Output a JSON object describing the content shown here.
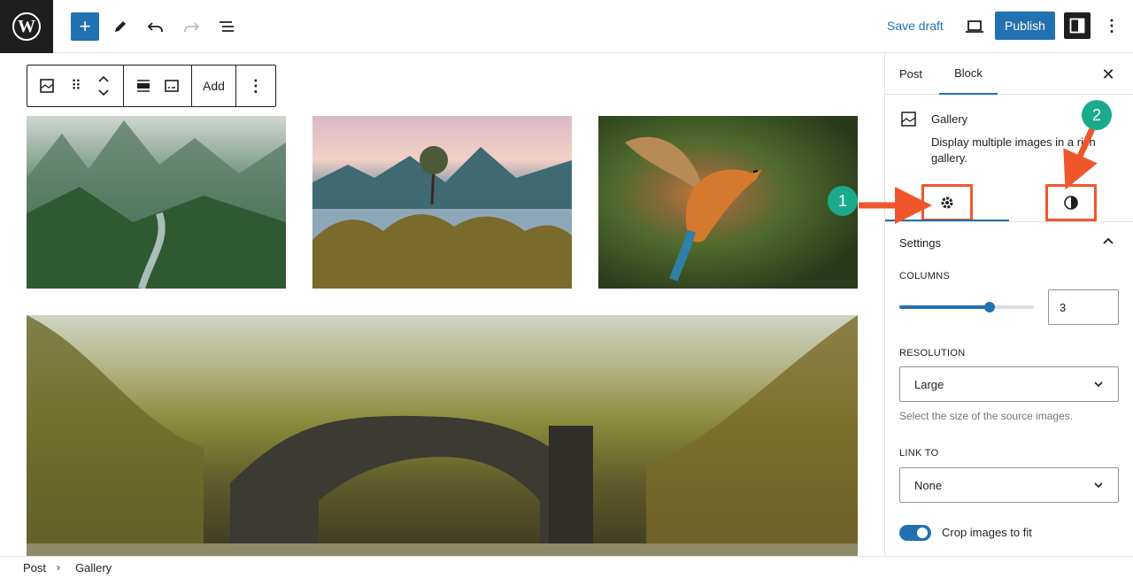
{
  "topbar": {
    "save_draft": "Save draft",
    "publish": "Publish"
  },
  "block_toolbar": {
    "add_label": "Add"
  },
  "sidebar": {
    "tabs": [
      {
        "label": "Post"
      },
      {
        "label": "Block"
      }
    ],
    "block_title": "Gallery",
    "block_description": "Display multiple images in a rich gallery.",
    "panel_title": "Settings",
    "columns_label": "COLUMNS",
    "columns_value": "3",
    "columns_fraction": 0.67,
    "resolution_label": "RESOLUTION",
    "resolution_value": "Large",
    "resolution_help": "Select the size of the source images.",
    "link_to_label": "LINK TO",
    "link_to_value": "None",
    "crop_label": "Crop images to fit",
    "crop_enabled": true
  },
  "annotations": [
    {
      "label": "1"
    },
    {
      "label": "2"
    }
  ],
  "colors": {
    "accent": "#2271b1",
    "annotation_arrow": "#f0562c",
    "annotation_badge": "#1aab8c"
  },
  "footer": {
    "breadcrumb": [
      "Post",
      "Gallery"
    ]
  }
}
